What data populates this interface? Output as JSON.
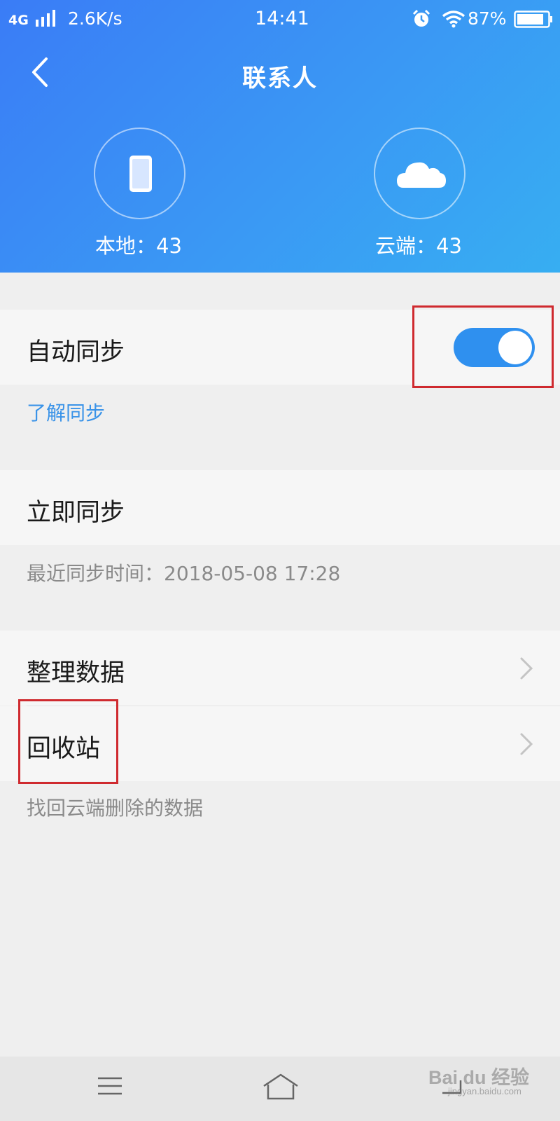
{
  "status_bar": {
    "network": "4G",
    "speed": "2.6K/s",
    "time": "14:41",
    "battery_percent": "87%"
  },
  "nav": {
    "title": "联系人"
  },
  "stats": {
    "local_label": "本地：43",
    "cloud_label": "云端：43"
  },
  "auto_sync": {
    "label": "自动同步",
    "enabled": true,
    "learn_link": "了解同步"
  },
  "sync_now": {
    "label": "立即同步",
    "last_sync": "最近同步时间：2018-05-08 17:28"
  },
  "organize": {
    "label": "整理数据"
  },
  "recycle": {
    "label": "回收站",
    "hint": "找回云端删除的数据"
  },
  "watermark": {
    "text": "Bai du 经验",
    "sub": "jingyan.baidu.com"
  },
  "colors": {
    "header_gradient_start": "#3a7cf6",
    "header_gradient_end": "#37aef2",
    "accent": "#2f90ef",
    "link": "#3a93e8",
    "highlight": "#cf2a2f"
  }
}
